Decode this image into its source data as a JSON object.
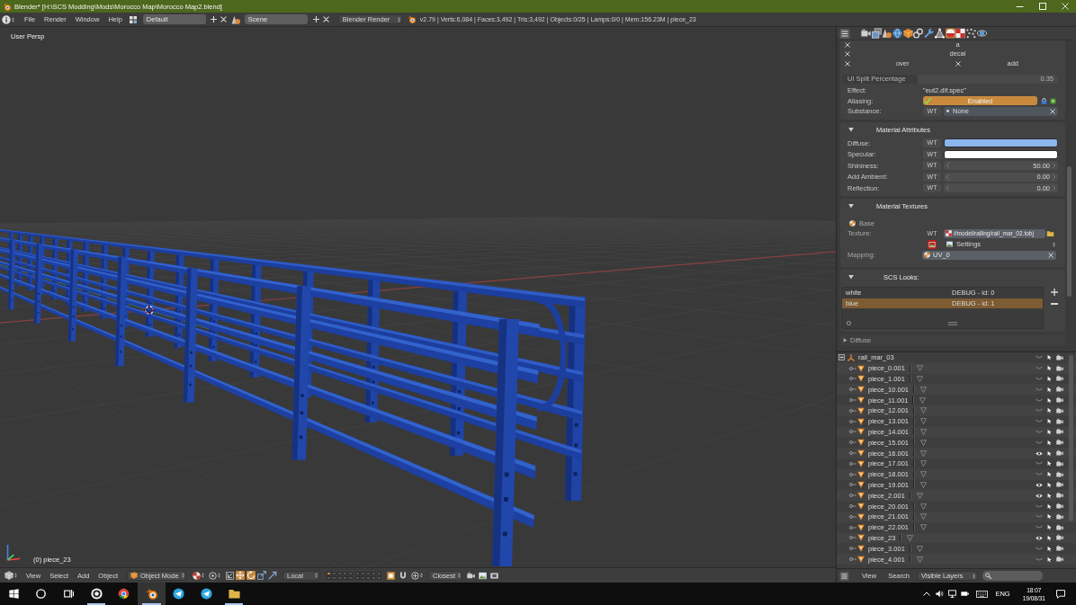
{
  "window": {
    "title": "Blender* [H:\\SCS Modding\\Mods\\Morocco Map\\Morocco Map2.blend]"
  },
  "menu_bar": {
    "menus": [
      "File",
      "Render",
      "Window",
      "Help"
    ],
    "screen_layout": "Default",
    "scene": "Scene",
    "render_engine": "Blender Render",
    "stats": "v2.79 | Verts:6,084 | Faces:3,492 | Tris:3,492 | Objects:0/25 | Lamps:0/0 | Mem:156.23M | piece_23"
  },
  "viewport": {
    "view_label": "User Persp",
    "object_label": "(0) piece_23"
  },
  "viewport_header": {
    "menus": [
      "View",
      "Select",
      "Add",
      "Object"
    ],
    "mode": "Object Mode",
    "manipulators": [
      {
        "kind": "move",
        "on": true
      },
      {
        "kind": "rotate",
        "on": true
      },
      {
        "kind": "scale",
        "on": false
      },
      {
        "kind": "arrow",
        "on": false
      }
    ],
    "orientation": "Local",
    "layers": [
      {
        "selected": true
      },
      {
        "selected": false
      },
      {
        "selected": false
      },
      {
        "selected": false
      },
      {
        "selected": false
      },
      {
        "selected": false
      },
      {
        "selected": false
      },
      {
        "selected": false
      },
      {
        "selected": false
      },
      {
        "selected": false
      },
      {
        "selected": false
      },
      {
        "selected": false
      },
      {
        "selected": false
      },
      {
        "selected": false
      },
      {
        "selected": false
      },
      {
        "selected": false
      },
      {
        "selected": false
      },
      {
        "selected": false
      },
      {
        "selected": false
      },
      {
        "selected": false
      }
    ],
    "snap_element": "Closest"
  },
  "properties": {
    "tabs": [
      {
        "kind": "camera",
        "selected": false
      },
      {
        "kind": "layers",
        "selected": false
      },
      {
        "kind": "scene",
        "selected": false
      },
      {
        "kind": "globe",
        "selected": false
      },
      {
        "kind": "cube",
        "selected": false
      },
      {
        "kind": "link",
        "selected": false
      },
      {
        "kind": "wrench",
        "selected": false
      },
      {
        "kind": "mesh",
        "selected": false
      },
      {
        "kind": "material",
        "selected": true
      },
      {
        "kind": "texture",
        "selected": false
      },
      {
        "kind": "particles",
        "selected": false
      },
      {
        "kind": "physics",
        "selected": false
      }
    ],
    "flag_rows": [
      [
        "a"
      ],
      [
        "decal"
      ],
      [
        "over",
        "add"
      ]
    ],
    "split": {
      "label": "UI Split Percentage",
      "value": "0.35",
      "level": 0.35,
      "disabled": true
    },
    "effect": {
      "label": "Effect:",
      "value": "\"eut2.dif.spec\""
    },
    "aliasing": {
      "label": "Aliasing:",
      "checked": true,
      "value": "Enabled"
    },
    "substance": {
      "label": "Substance:",
      "flag": "WT",
      "value": "None"
    },
    "material_attributes": {
      "title": "Material Attributes",
      "expanded": true,
      "rows": [
        {
          "kind": "color",
          "label": "Diffuse:",
          "flag": "WT",
          "color": "#8cb6ee"
        },
        {
          "kind": "color",
          "label": "Specular:",
          "flag": "WT",
          "color": "#ffffff"
        },
        {
          "kind": "number",
          "label": "Shininess:",
          "flag": "WT",
          "value": "50.00"
        },
        {
          "kind": "number",
          "label": "Add Ambient:",
          "flag": "WT",
          "value": "0.00"
        },
        {
          "kind": "number",
          "label": "Reflection:",
          "flag": "WT",
          "value": "0.00"
        }
      ]
    },
    "material_textures": {
      "title": "Material Textures",
      "expanded": true,
      "texture": "Base",
      "texture_label": "Texture:",
      "flag": "WT",
      "path": "//model/railing/rail_mar_02.tobj",
      "settings": "Settings",
      "mapping_label": "Mapping:",
      "mapping": "UV_0"
    },
    "scs_looks": {
      "title": "SCS Looks:",
      "expanded": true,
      "looks": [
        {
          "name": "white",
          "info": "DEBUG - id: 0",
          "selected": false
        },
        {
          "name": "blue",
          "info": "DEBUG - id: 1",
          "selected": true
        }
      ]
    },
    "diffuse_panel": {
      "title": "Diffuse",
      "expanded": false
    }
  },
  "outliner": {
    "root": {
      "name": "rail_mar_03",
      "expanded": true,
      "visible": false,
      "children": [
        {
          "name": "piece_0.001",
          "visible": false
        },
        {
          "name": "piece_1.001",
          "visible": false
        },
        {
          "name": "piece_10.001",
          "visible": false
        },
        {
          "name": "piece_11.001",
          "visible": false
        },
        {
          "name": "piece_12.001",
          "visible": false
        },
        {
          "name": "piece_13.001",
          "visible": false
        },
        {
          "name": "piece_14.001",
          "visible": false
        },
        {
          "name": "piece_15.001",
          "visible": false
        },
        {
          "name": "piece_16.001",
          "visible": true
        },
        {
          "name": "piece_17.001",
          "visible": false
        },
        {
          "name": "piece_18.001",
          "visible": false
        },
        {
          "name": "piece_19.001",
          "visible": true
        },
        {
          "name": "piece_2.001",
          "visible": true
        },
        {
          "name": "piece_20.001",
          "visible": false
        },
        {
          "name": "piece_21.001",
          "visible": false
        },
        {
          "name": "piece_22.001",
          "visible": false
        },
        {
          "name": "piece_23",
          "visible": true
        },
        {
          "name": "piece_3.001",
          "visible": false
        },
        {
          "name": "piece_4.001",
          "visible": false
        }
      ]
    },
    "footer": {
      "menus": [
        "View",
        "Search"
      ],
      "filter": "Visible Layers"
    }
  },
  "taskbar": {
    "apps": [
      {
        "kind": "ring",
        "running": true,
        "active": false
      },
      {
        "kind": "wheel",
        "running": false,
        "active": false
      },
      {
        "kind": "orbit",
        "running": true,
        "active": true
      },
      {
        "kind": "plane",
        "running": false,
        "active": false
      },
      {
        "kind": "plane",
        "running": false,
        "active": false
      },
      {
        "kind": "folder",
        "running": true,
        "active": false
      }
    ],
    "language": "ENG",
    "time": "18:07",
    "date": "19/08/31"
  }
}
